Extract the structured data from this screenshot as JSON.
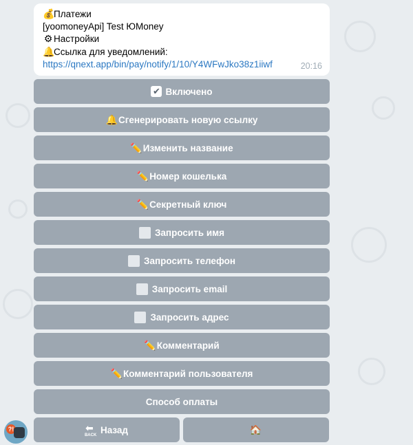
{
  "message": {
    "lines": [
      {
        "icon": "money-bag-icon",
        "glyph": "💰",
        "text": "Платежи"
      },
      {
        "icon": "",
        "glyph": "",
        "text": "[yoomoneyApi] Test ЮMoney"
      },
      {
        "icon": "gear-icon",
        "glyph": "⚙",
        "text": "Настройки"
      },
      {
        "icon": "bell-icon",
        "glyph": "🔔",
        "text": "Ссылка для уведомлений:"
      }
    ],
    "link": "https://qnext.app/bin/pay/notify/1/10/Y4WFwJko38z1iiwf",
    "time": "20:16"
  },
  "keyboard": {
    "enabled": "Включено",
    "generate_link": "Сгенерировать новую ссылку",
    "rename": "Изменить название",
    "wallet_number": "Номер кошелька",
    "secret_key": "Секретный ключ",
    "ask_name": "Запросить имя",
    "ask_phone": "Запросить телефон",
    "ask_email": "Запросить email",
    "ask_address": "Запросить адрес",
    "comment": "Комментарий",
    "user_comment": "Комментарий пользователя",
    "payment_method": "Способ оплаты",
    "back": "Назад",
    "back_icon_text": "BACK"
  },
  "icons": {
    "check": "✔",
    "bell": "🔔",
    "pencil": "✏️",
    "back_arrow": "⬅",
    "home": "🏠"
  },
  "colors": {
    "link": "#2b78c2",
    "button_bg": "#808c98",
    "background": "#e9edf0"
  },
  "avatar": {
    "badge": "?!"
  }
}
